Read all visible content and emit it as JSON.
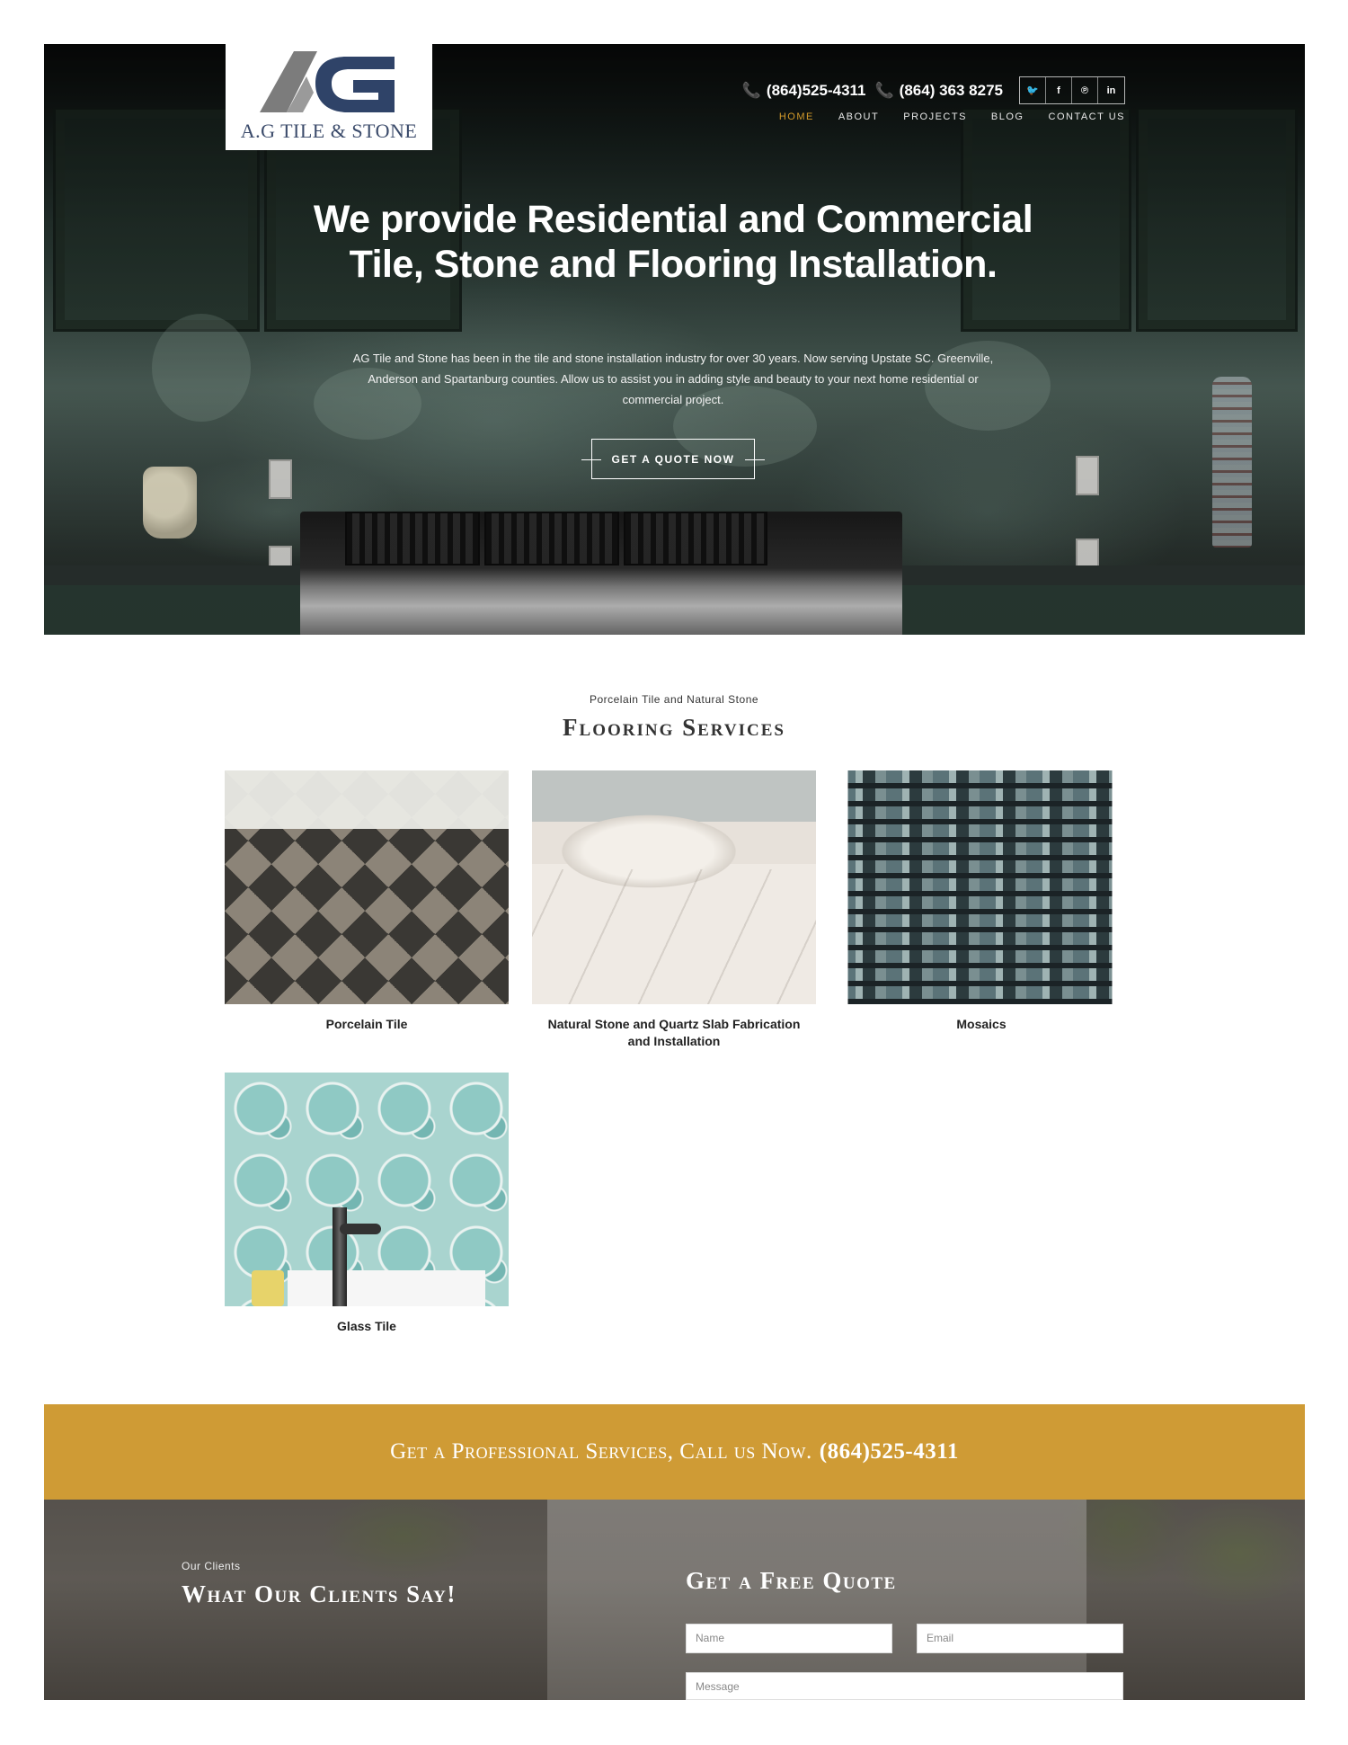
{
  "brand": {
    "logo_text": "A.G TILE & STONE",
    "logo_mark_text": "AG",
    "logo_color": "#3a4a6a"
  },
  "header": {
    "phones": [
      "(864)525-4311",
      "(864) 363 8275"
    ],
    "phone_icon": "phone-icon",
    "socials": [
      {
        "name": "twitter-icon",
        "glyph": "🐦"
      },
      {
        "name": "facebook-icon",
        "glyph": "f"
      },
      {
        "name": "pinterest-icon",
        "glyph": "℗"
      },
      {
        "name": "linkedin-icon",
        "glyph": "in"
      }
    ],
    "nav": [
      {
        "label": "HOME",
        "active": true
      },
      {
        "label": "ABOUT",
        "active": false
      },
      {
        "label": "PROJECTS",
        "active": false
      },
      {
        "label": "BLOG",
        "active": false
      },
      {
        "label": "CONTACT US",
        "active": false
      }
    ],
    "accent_color": "#d49a2a"
  },
  "hero": {
    "title": "We provide Residential and Commercial Tile, Stone and Flooring Installation.",
    "subtitle": "AG Tile and Stone has been in the tile and stone installation industry for over 30 years. Now serving Upstate SC. Greenville, Anderson and Spartanburg counties. Allow us to assist you in adding style and beauty to your next home residential or commercial project.",
    "cta_label": "GET A QUOTE NOW"
  },
  "services": {
    "kicker": "Porcelain Tile and Natural Stone",
    "title": "Flooring Services",
    "items": [
      {
        "label": "Porcelain Tile"
      },
      {
        "label": "Natural Stone and Quartz Slab Fabrication and Installation"
      },
      {
        "label": "Mosaics"
      },
      {
        "label": "Glass Tile"
      }
    ]
  },
  "cta_band": {
    "text": "Get a Professional Services, Call us Now.",
    "phone": "(864)525-4311",
    "color": "#cf9b35"
  },
  "clients": {
    "kicker": "Our Clients",
    "title": "What Our Clients Say!"
  },
  "quote_form": {
    "title": "Get a Free Quote",
    "name_placeholder": "Name",
    "email_placeholder": "Email",
    "message_placeholder": "Message"
  }
}
